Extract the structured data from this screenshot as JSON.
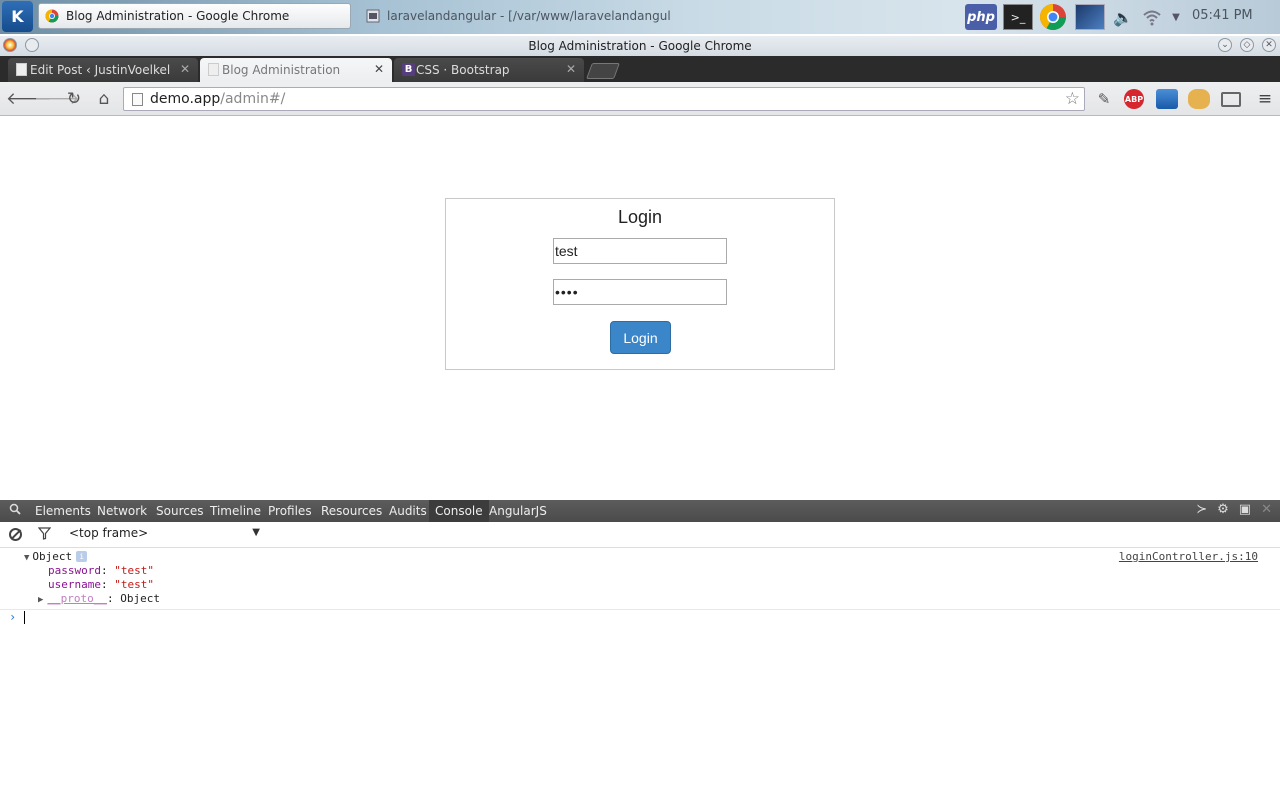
{
  "kde_panel": {
    "logo": "K",
    "tasks": [
      {
        "label": "Blog Administration - Google Chrome",
        "icon": "chrome-icon"
      },
      {
        "label": "laravelandangular - [/var/www/laravelandangular.co",
        "icon": "konsole-icon"
      }
    ],
    "tray": {
      "php_label": "php",
      "terminal_label": ">_"
    },
    "clock": "05:41 PM"
  },
  "window": {
    "title": "Blog Administration - Google Chrome",
    "controls": {
      "minimize": "⌄",
      "maximize": "◇",
      "close": "✕"
    }
  },
  "tabs": [
    {
      "label": "Edit Post ‹ JustinVoelkel",
      "close": "✕"
    },
    {
      "label": "Blog Administration",
      "close": "✕"
    },
    {
      "label": "CSS · Bootstrap",
      "close": "✕",
      "fav_letter": "B"
    }
  ],
  "toolbar": {
    "url_host": "demo.app",
    "url_path": "/admin#/",
    "abp_label": "ABP"
  },
  "page": {
    "login_title": "Login",
    "username_value": "test",
    "password_value": "••••",
    "login_button": "Login"
  },
  "devtools": {
    "tabs": [
      "Elements",
      "Network",
      "Sources",
      "Timeline",
      "Profiles",
      "Resources",
      "Audits",
      "Console",
      "AngularJS"
    ],
    "active_tab": "Console",
    "frame_select": "<top frame>",
    "console": {
      "object_label": "Object",
      "info_badge": "i",
      "source": "loginController.js:10",
      "props": [
        {
          "key": "password",
          "value": "\"test\""
        },
        {
          "key": "username",
          "value": "\"test\""
        }
      ],
      "proto_key": "__proto__",
      "proto_value": ": Object",
      "prompt": "›"
    }
  },
  "colors": {
    "login_button": "#3a86c8",
    "prop_key": "#881391",
    "prop_string": "#c41a16"
  }
}
